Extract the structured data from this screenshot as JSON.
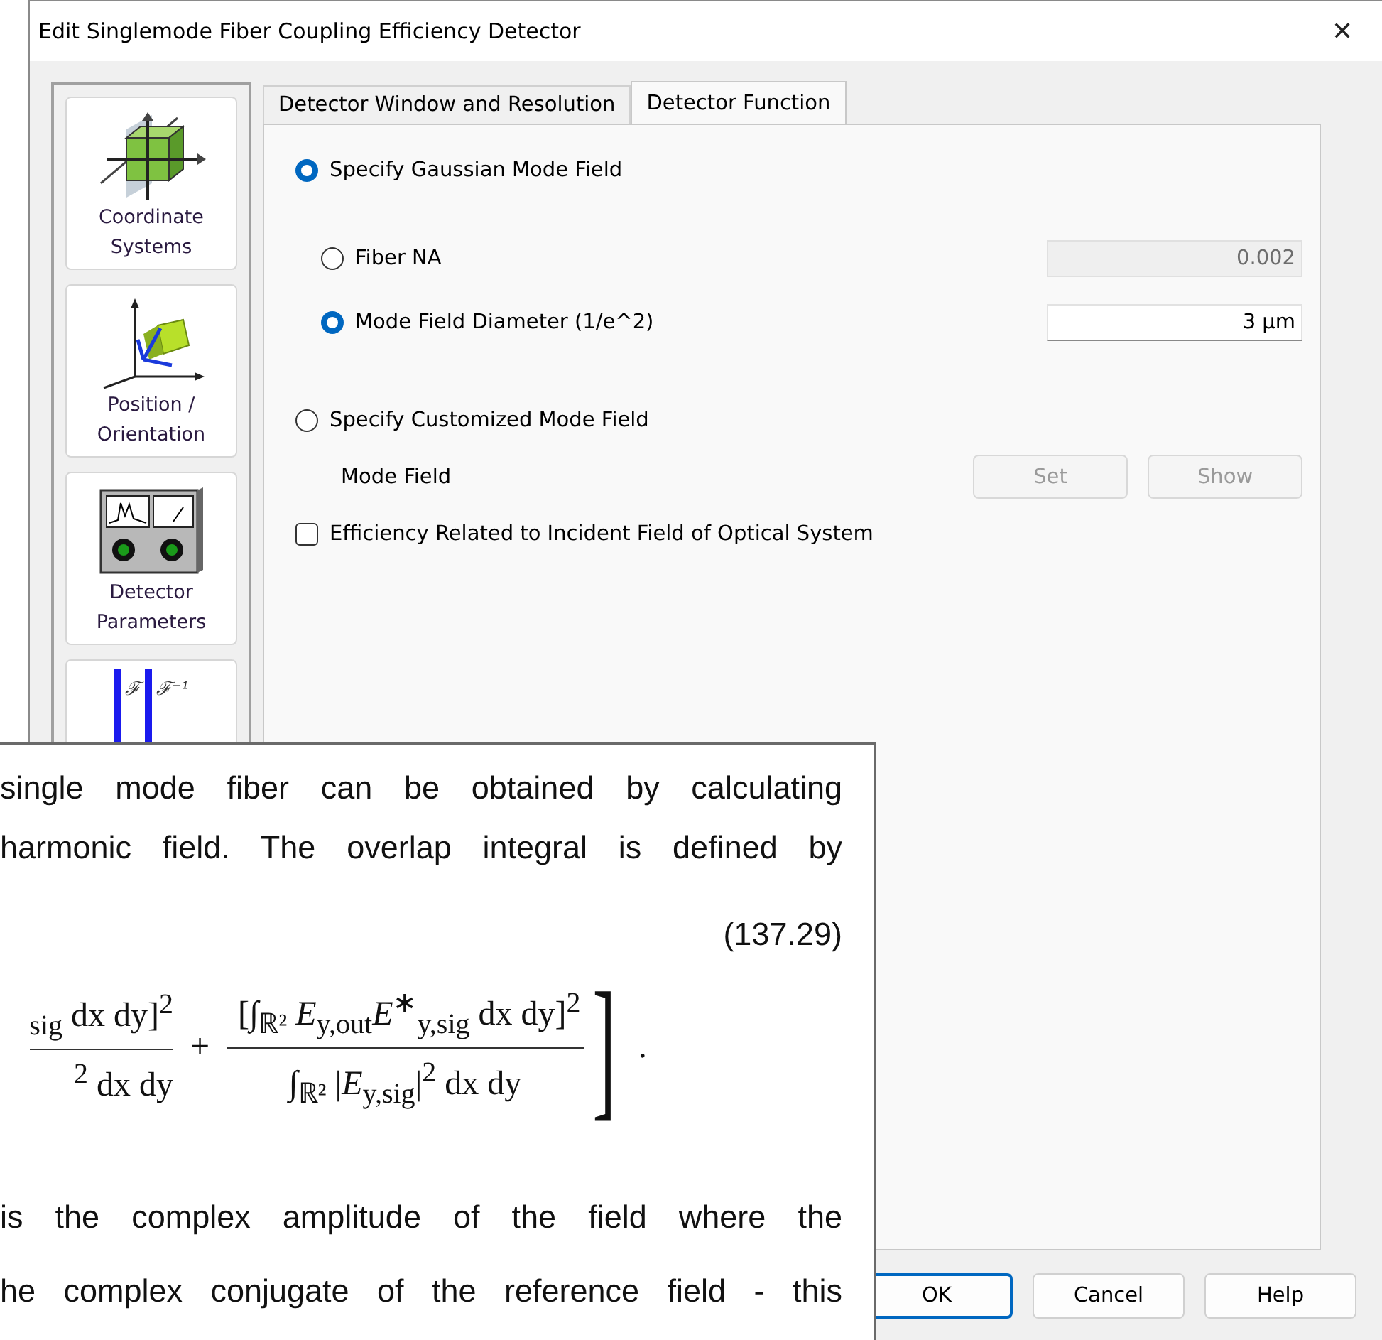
{
  "window": {
    "title": "Edit Singlemode Fiber Coupling Efficiency Detector",
    "close": "✕"
  },
  "sidebar": {
    "items": [
      {
        "kind": "coordinates",
        "label": "Coordinate Systems"
      },
      {
        "kind": "position",
        "label": "Position / Orientation"
      },
      {
        "kind": "detector",
        "label": "Detector Parameters"
      },
      {
        "kind": "fourier",
        "glyphs": [
          "ℱ",
          "ℱ⁻¹"
        ]
      }
    ]
  },
  "tabs": [
    {
      "label": "Detector Window and Resolution",
      "selected": false
    },
    {
      "label": "Detector Function",
      "selected": true
    }
  ],
  "detector_function": {
    "gaussian": {
      "label": "Specify Gaussian Mode Field",
      "selected": true
    },
    "fiber_na": {
      "label": "Fiber NA",
      "selected": false,
      "value": "0.002",
      "disabled": true
    },
    "mode_field_diameter": {
      "label": "Mode Field Diameter (1/e^2)",
      "selected": true,
      "value": "3 µm",
      "disabled": false
    },
    "customized": {
      "label": "Specify Customized Mode Field",
      "selected": false
    },
    "mode_field": {
      "label": "Mode Field",
      "buttons": [
        {
          "label": "Set",
          "disabled": true
        },
        {
          "label": "Show",
          "disabled": true
        }
      ]
    },
    "efficiency": {
      "label": "Efficiency Related to Incident Field of Optical System",
      "checked": false
    }
  },
  "buttons": [
    {
      "label": "OK",
      "default": true
    },
    {
      "label": "Cancel",
      "default": false
    },
    {
      "label": "Help",
      "default": false
    }
  ],
  "document_excerpt": {
    "lines_before": [
      "single mode fiber can be obtained by calculating",
      "harmonic field. The overlap integral is defined by"
    ],
    "equation_number": "(137.29)",
    "formula": {
      "term_1": {
        "numerator": "$_{sig}$ dx dy]$^{2}$",
        "denominator": "$^{2}$ dx dy"
      },
      "operator": "+",
      "term_2": {
        "numerator": "[∫$_{ℝ²}$ *E*$_{y,out}$*E*$^{∗}$$_{y,sig}$ dx dy]$^{2}$",
        "denominator": "∫$_{ℝ²}$ |*E*$_{y,sig}$|$^{2}$ dx dy"
      },
      "bracket": "]",
      "end": "."
    },
    "lines_after": [
      "is the complex amplitude of the field where the",
      "he complex conjugate of the reference field - this"
    ]
  }
}
